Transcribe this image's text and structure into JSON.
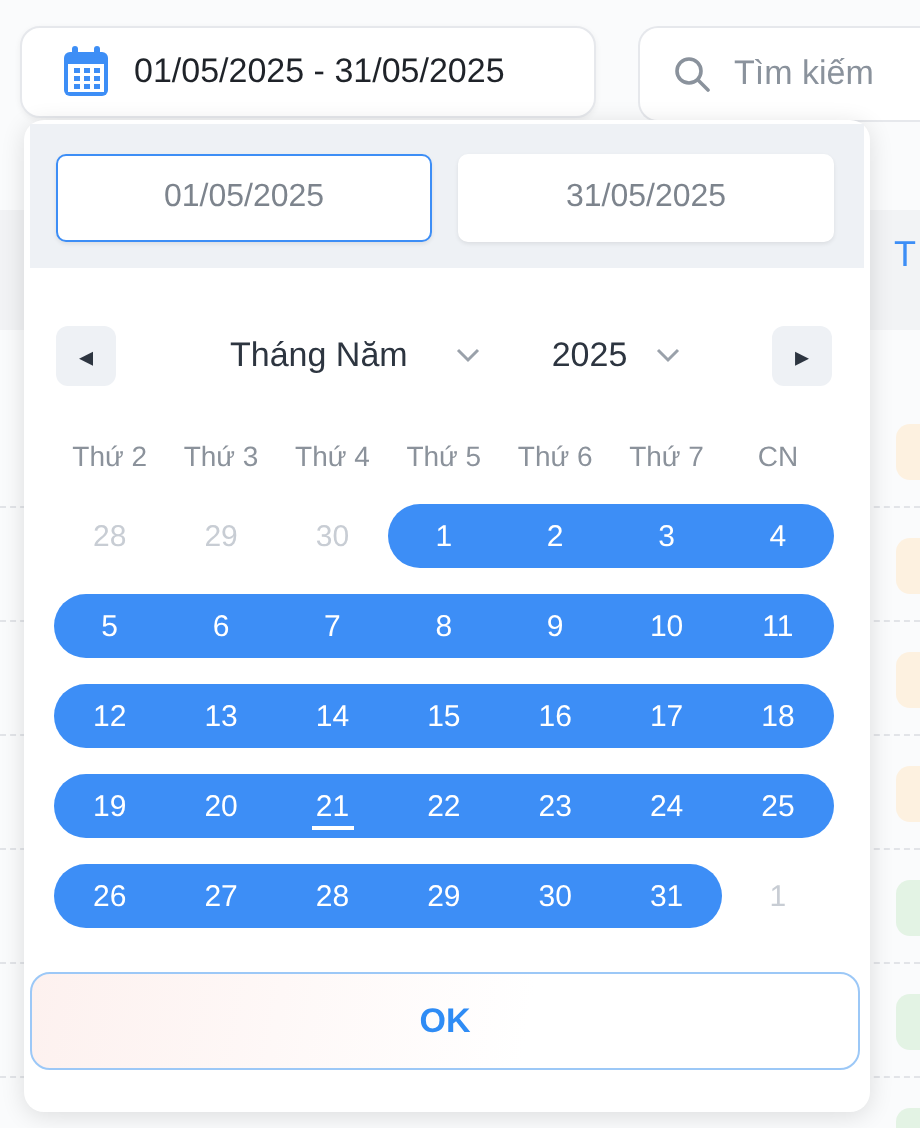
{
  "date_range_button": {
    "label": "01/05/2025 - 31/05/2025"
  },
  "search": {
    "placeholder": "Tìm kiếm"
  },
  "table": {
    "column_header": "T",
    "rows": [
      {
        "color": "#fdf1e0"
      },
      {
        "color": "#fdf1e0"
      },
      {
        "color": "#fdf1e0"
      },
      {
        "color": "#fdf1e0"
      },
      {
        "color": "#e3f3e4"
      },
      {
        "color": "#e3f3e4"
      },
      {
        "color": "#e3f3e4"
      }
    ]
  },
  "date_picker": {
    "fields": [
      {
        "value": "01/05/2025",
        "selected": true
      },
      {
        "value": "31/05/2025",
        "selected": false
      }
    ],
    "prev": "◂",
    "next": "▸",
    "month": "Tháng Năm",
    "year": "2025",
    "weekdays": [
      "Thứ 2",
      "Thứ 3",
      "Thứ 4",
      "Thứ 5",
      "Thứ 6",
      "Thứ 7",
      "CN"
    ],
    "weeks": [
      {
        "days": [
          {
            "day": "28",
            "muted": true,
            "in_range": false,
            "today": false
          },
          {
            "day": "29",
            "muted": true,
            "in_range": false,
            "today": false
          },
          {
            "day": "30",
            "muted": true,
            "in_range": false,
            "today": false
          },
          {
            "day": "1",
            "muted": false,
            "in_range": true,
            "today": false
          },
          {
            "day": "2",
            "muted": false,
            "in_range": true,
            "today": false
          },
          {
            "day": "3",
            "muted": false,
            "in_range": true,
            "today": false
          },
          {
            "day": "4",
            "muted": false,
            "in_range": true,
            "today": false
          }
        ]
      },
      {
        "days": [
          {
            "day": "5",
            "muted": false,
            "in_range": true,
            "today": false
          },
          {
            "day": "6",
            "muted": false,
            "in_range": true,
            "today": false
          },
          {
            "day": "7",
            "muted": false,
            "in_range": true,
            "today": false
          },
          {
            "day": "8",
            "muted": false,
            "in_range": true,
            "today": false
          },
          {
            "day": "9",
            "muted": false,
            "in_range": true,
            "today": false
          },
          {
            "day": "10",
            "muted": false,
            "in_range": true,
            "today": false
          },
          {
            "day": "11",
            "muted": false,
            "in_range": true,
            "today": false
          }
        ]
      },
      {
        "days": [
          {
            "day": "12",
            "muted": false,
            "in_range": true,
            "today": false
          },
          {
            "day": "13",
            "muted": false,
            "in_range": true,
            "today": false
          },
          {
            "day": "14",
            "muted": false,
            "in_range": true,
            "today": false
          },
          {
            "day": "15",
            "muted": false,
            "in_range": true,
            "today": false
          },
          {
            "day": "16",
            "muted": false,
            "in_range": true,
            "today": false
          },
          {
            "day": "17",
            "muted": false,
            "in_range": true,
            "today": false
          },
          {
            "day": "18",
            "muted": false,
            "in_range": true,
            "today": false
          }
        ]
      },
      {
        "days": [
          {
            "day": "19",
            "muted": false,
            "in_range": true,
            "today": false
          },
          {
            "day": "20",
            "muted": false,
            "in_range": true,
            "today": false
          },
          {
            "day": "21",
            "muted": false,
            "in_range": true,
            "today": true
          },
          {
            "day": "22",
            "muted": false,
            "in_range": true,
            "today": false
          },
          {
            "day": "23",
            "muted": false,
            "in_range": true,
            "today": false
          },
          {
            "day": "24",
            "muted": false,
            "in_range": true,
            "today": false
          },
          {
            "day": "25",
            "muted": false,
            "in_range": true,
            "today": false
          }
        ]
      },
      {
        "days": [
          {
            "day": "26",
            "muted": false,
            "in_range": true,
            "today": false
          },
          {
            "day": "27",
            "muted": false,
            "in_range": true,
            "today": false
          },
          {
            "day": "28",
            "muted": false,
            "in_range": true,
            "today": false
          },
          {
            "day": "29",
            "muted": false,
            "in_range": true,
            "today": false
          },
          {
            "day": "30",
            "muted": false,
            "in_range": true,
            "today": false
          },
          {
            "day": "31",
            "muted": false,
            "in_range": true,
            "today": false
          },
          {
            "day": "1",
            "muted": true,
            "in_range": false,
            "today": false
          }
        ]
      }
    ],
    "ok": "OK"
  }
}
